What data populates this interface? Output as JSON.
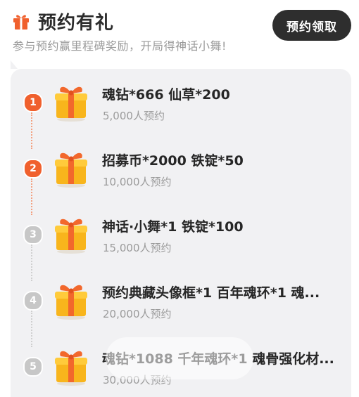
{
  "header": {
    "title": "预约有礼",
    "subtitle": "参与预约赢里程碑奖励，开局得神话小舞!",
    "button_label": "预约领取",
    "icon": "gift-icon"
  },
  "colors": {
    "accent": "#f0602d",
    "inactive": "#c7c7c7",
    "panel_bg": "#f1f1f3",
    "button_bg": "#2e2e2e"
  },
  "rewards": [
    {
      "index": "1",
      "title": "魂钻*666  仙草*200",
      "count": "5,000人预约",
      "unlocked": true
    },
    {
      "index": "2",
      "title": "招募币*2000  铁锭*50",
      "count": "10,000人预约",
      "unlocked": true
    },
    {
      "index": "3",
      "title": "神话·小舞*1  铁锭*100",
      "count": "15,000人预约",
      "unlocked": false
    },
    {
      "index": "4",
      "title": "预约典藏头像框*1  百年魂环*1  魂...",
      "count": "20,000人预约",
      "unlocked": false
    },
    {
      "index": "5",
      "title": "魂钻*1088  千年魂环*1  魂骨强化材...",
      "count": "30,000人预约",
      "unlocked": false
    }
  ]
}
